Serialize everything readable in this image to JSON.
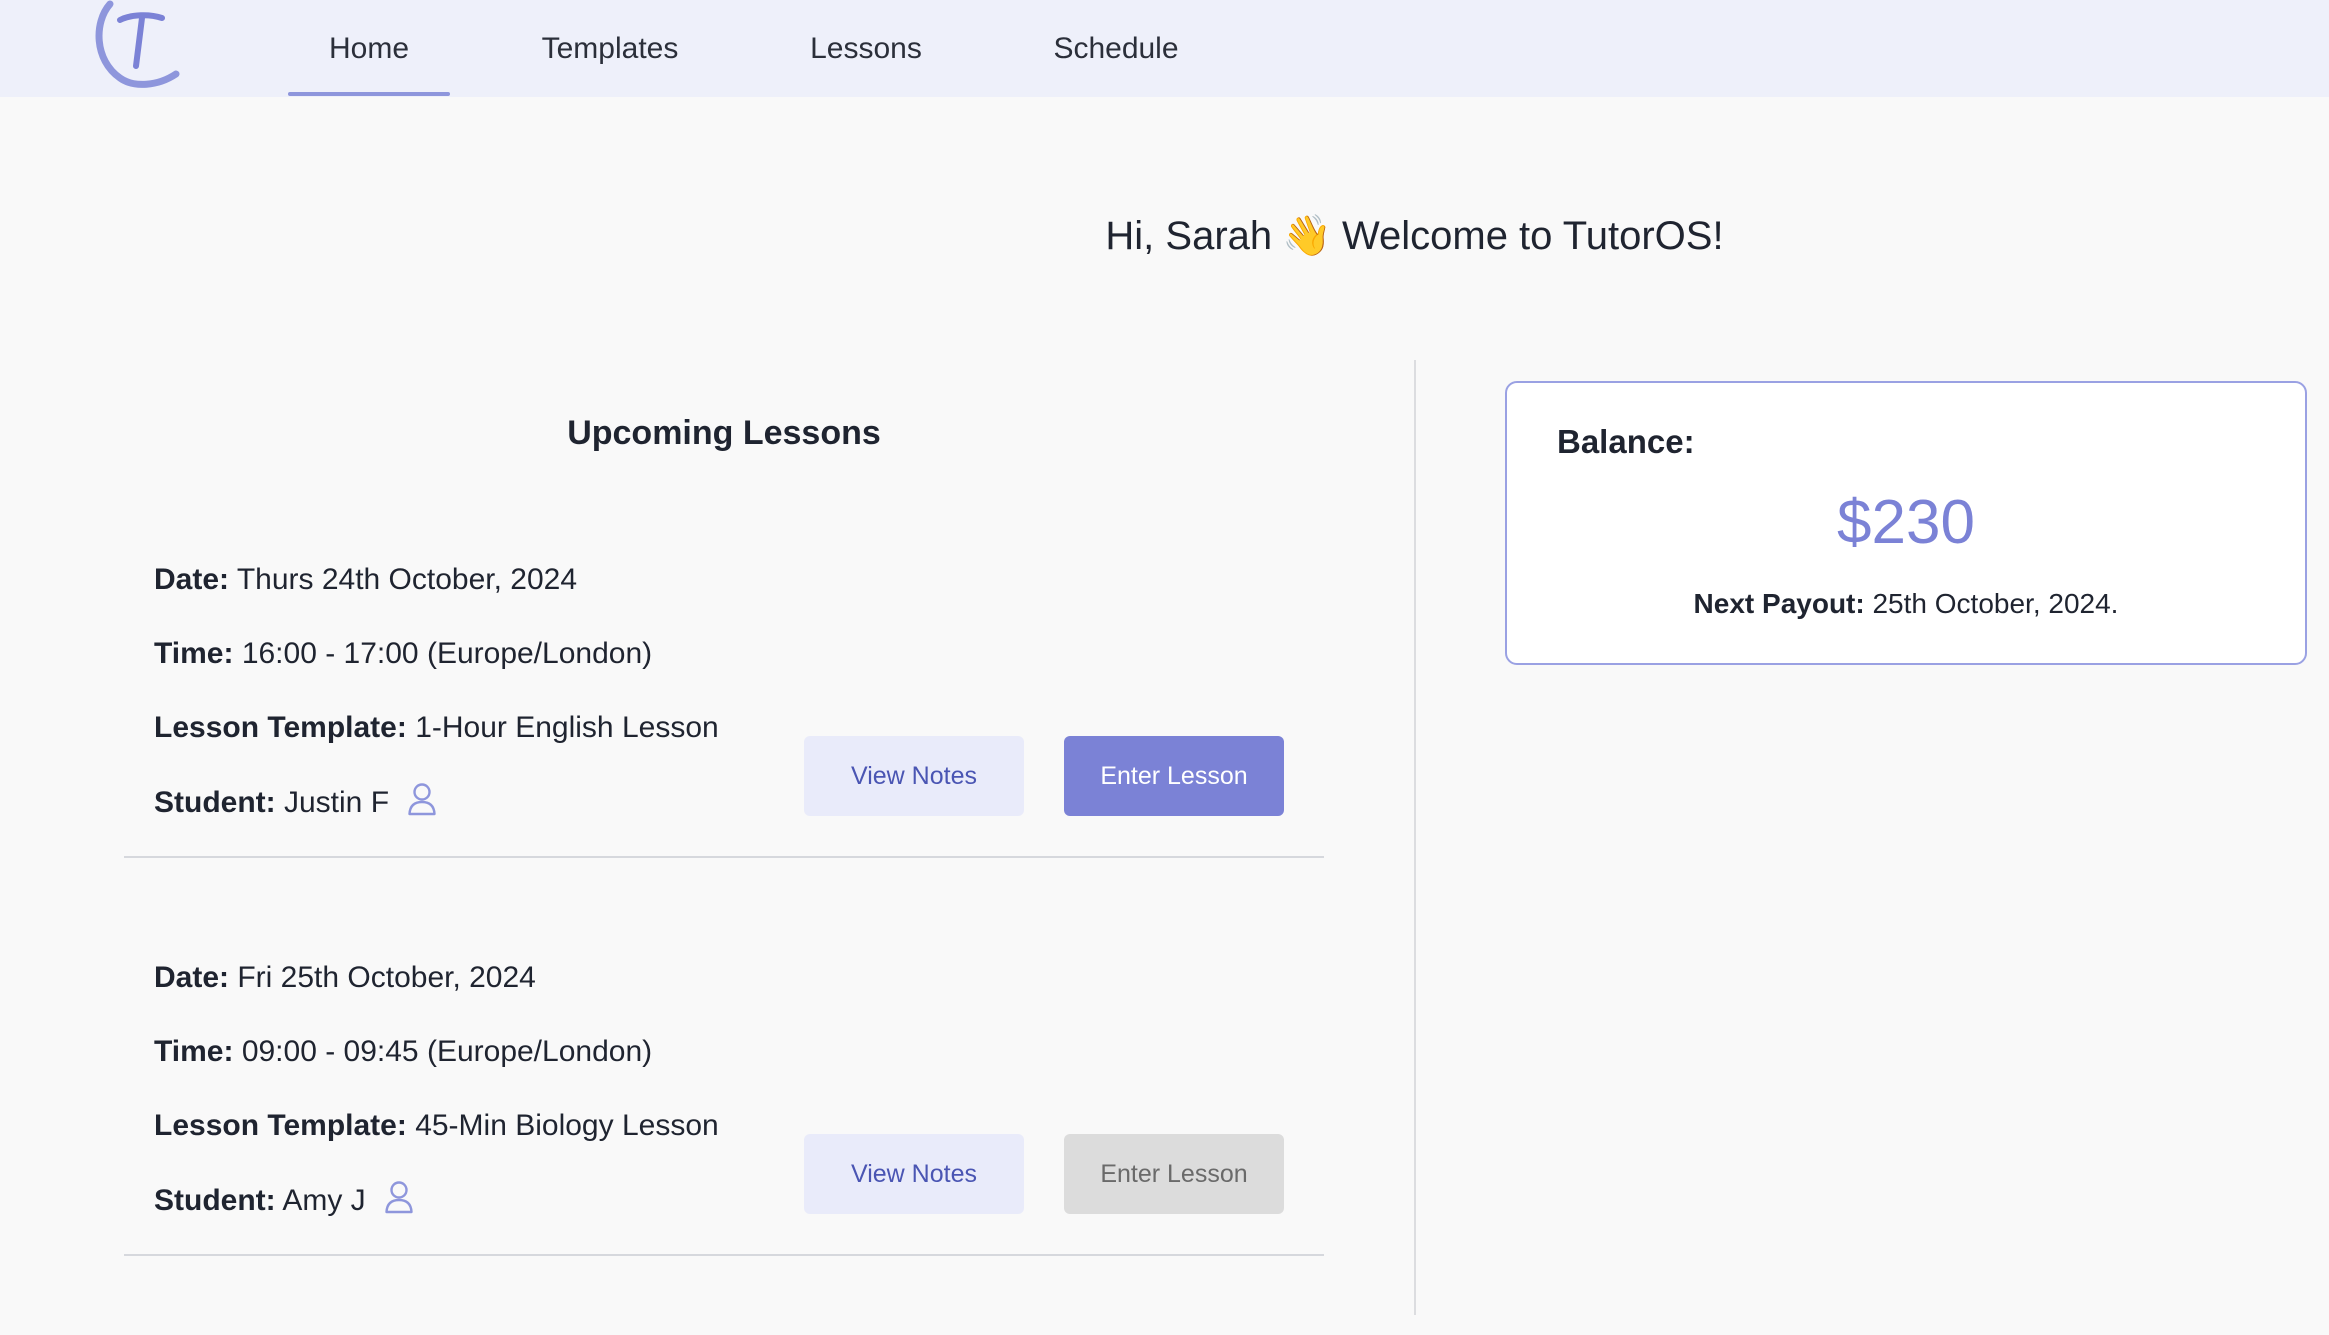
{
  "nav": {
    "tabs": [
      {
        "label": "Home",
        "active": true
      },
      {
        "label": "Templates",
        "active": false
      },
      {
        "label": "Lessons",
        "active": false
      },
      {
        "label": "Schedule",
        "active": false
      }
    ],
    "logo_icon": "tutoros-logo-icon"
  },
  "greeting": {
    "prefix": "Hi, Sarah",
    "emoji": "👋",
    "suffix": "Welcome to TutorOS!"
  },
  "upcoming": {
    "title": "Upcoming Lessons",
    "labels": {
      "date": "Date:",
      "time": "Time:",
      "template": "Lesson Template:",
      "student": "Student:"
    },
    "lessons": [
      {
        "date": "Thurs 24th October, 2024",
        "time": "16:00 - 17:00 (Europe/London)",
        "template": "1-Hour English Lesson",
        "student": "Justin F",
        "view_notes_label": "View Notes",
        "enter_label": "Enter Lesson",
        "enter_enabled": true
      },
      {
        "date": "Fri 25th October, 2024",
        "time": "09:00 - 09:45 (Europe/London)",
        "template": "45-Min Biology Lesson",
        "student": "Amy J",
        "view_notes_label": "View Notes",
        "enter_label": "Enter Lesson",
        "enter_enabled": false
      }
    ]
  },
  "balance": {
    "label": "Balance:",
    "amount": "$230",
    "payout_label": "Next Payout:",
    "payout_date": "25th October, 2024."
  },
  "colors": {
    "accent": "#7b82d6",
    "nav_bg": "#eef0fa",
    "page_bg": "#f9f9f9",
    "notes_btn_bg": "#e9ebfa",
    "disabled_btn_bg": "#dcdcdc"
  }
}
